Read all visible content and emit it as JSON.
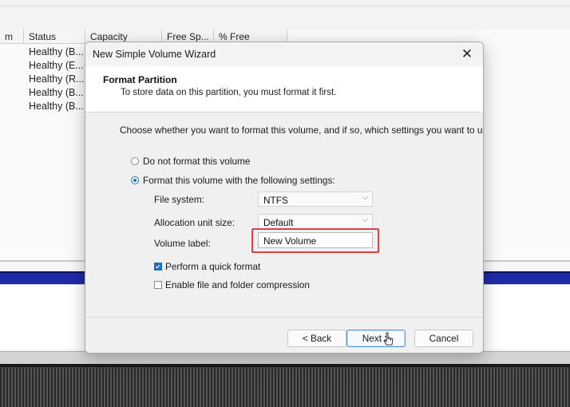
{
  "background": {
    "columns": [
      "m",
      "Status",
      "Capacity",
      "Free Sp...",
      "% Free"
    ],
    "status_rows": [
      "Healthy (B...",
      "Healthy (E...",
      "Healthy (R...",
      "Healthy (B...",
      "Healthy (B..."
    ]
  },
  "dialog": {
    "title": "New Simple Volume Wizard",
    "close_glyph": "✕",
    "header_title": "Format Partition",
    "header_subtitle": "To store data on this partition, you must format it first.",
    "instruction": "Choose whether you want to format this volume, and if so, which settings you want to use.",
    "radio_no_format": "Do not format this volume",
    "radio_format": "Format this volume with the following settings:",
    "selected_option": "format",
    "file_system_label": "File system:",
    "file_system_value": "NTFS",
    "allocation_label": "Allocation unit size:",
    "allocation_value": "Default",
    "volume_label_label": "Volume label:",
    "volume_label_value": "New Volume",
    "quick_format_label": "Perform a quick format",
    "quick_format_checked": true,
    "compression_label": "Enable file and folder compression",
    "compression_checked": false,
    "back_button": "< Back",
    "next_button": "Next >",
    "cancel_button": "Cancel",
    "chevron_glyph": "⌵"
  },
  "colors": {
    "accent": "#1f6fc9",
    "highlight_box": "#e0403f",
    "disk_bar": "#1f2aa6"
  }
}
